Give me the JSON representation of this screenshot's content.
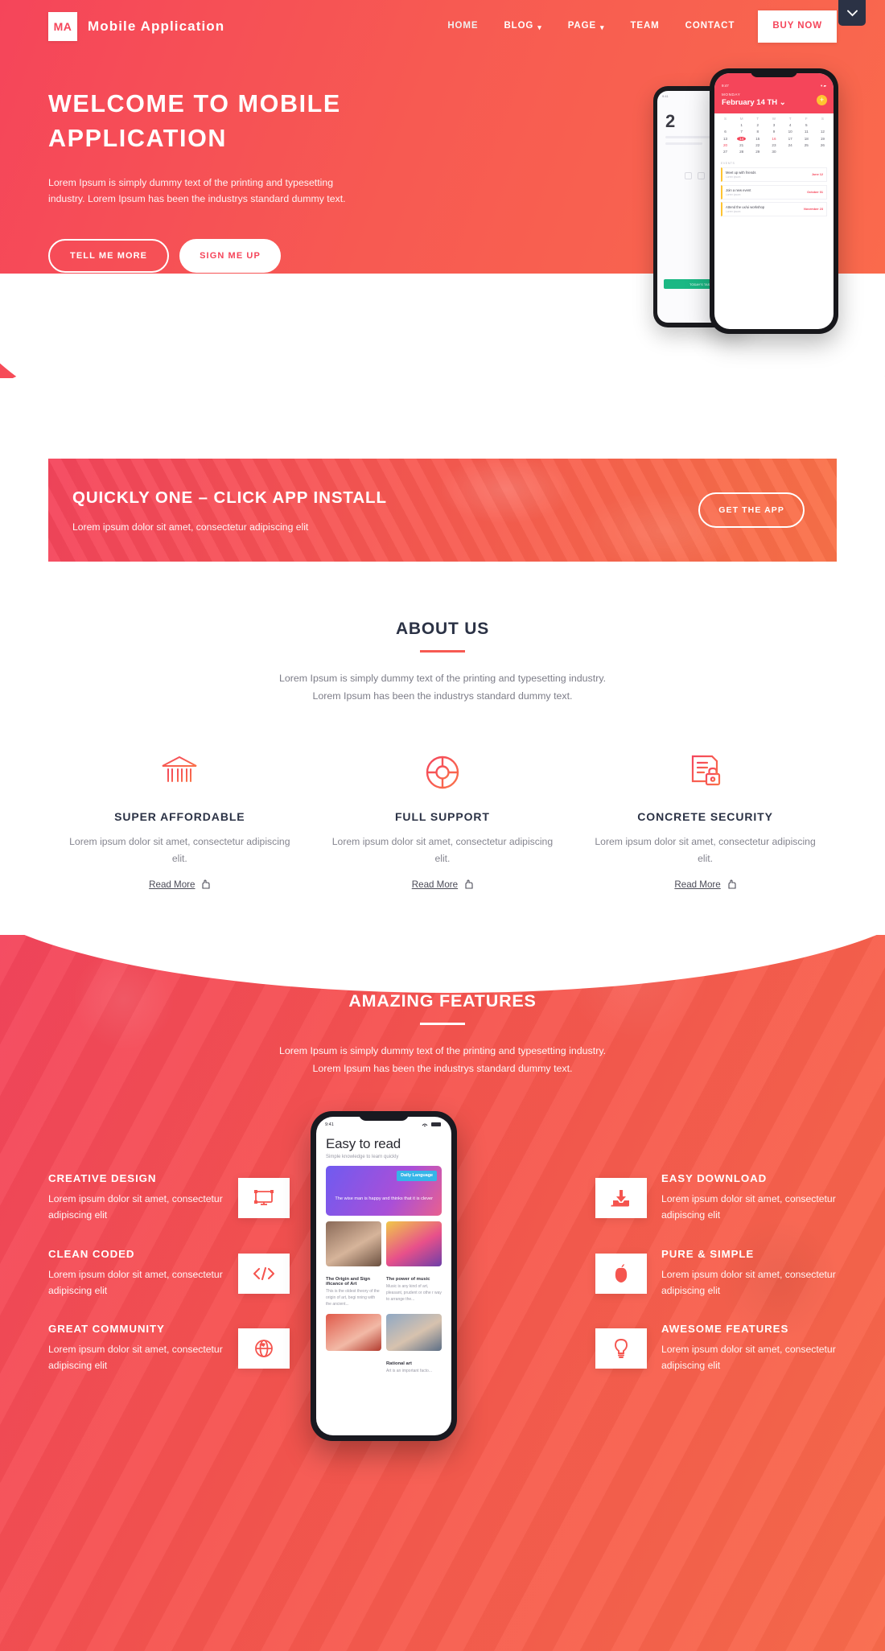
{
  "brand": {
    "badge": "MA",
    "name": "Mobile Application"
  },
  "nav": {
    "items": [
      {
        "label": "HOME",
        "caret": ""
      },
      {
        "label": "BLOG",
        "caret": "▾"
      },
      {
        "label": "PAGE",
        "caret": "▾"
      },
      {
        "label": "TEAM",
        "caret": ""
      },
      {
        "label": "CONTACT",
        "caret": ""
      }
    ],
    "cta": "BUY NOW",
    "scroll_toggle_icon": "chevron-down-icon"
  },
  "hero": {
    "title": "WELCOME TO MOBILE APPLICATION",
    "subtitle": "Lorem Ipsum is simply dummy text of the printing and typesetting industry. Lorem Ipsum has been the industrys standard dummy text.",
    "btn_primary": "TELL ME MORE",
    "btn_secondary": "SIGN ME UP",
    "phone_back": {
      "status": "9:41",
      "big_number": "2",
      "green_label": "TODAY'S TASK"
    },
    "phone_front": {
      "status_left": "9:47",
      "status_right": "▾ ▰",
      "weekday": "MONDAY",
      "date": "February 14 TH ⌄",
      "plus": "+",
      "dow": [
        "S",
        "M",
        "T",
        "W",
        "T",
        "F",
        "S"
      ],
      "weeks": [
        [
          "",
          "1",
          "2",
          "3",
          "4",
          "5"
        ],
        [
          "6",
          "7",
          "8",
          "9",
          "10",
          "11",
          "12"
        ],
        [
          "13",
          "14",
          "15",
          "16",
          "17",
          "18",
          "19"
        ],
        [
          "20",
          "21",
          "22",
          "23",
          "24",
          "25",
          "26"
        ],
        [
          "27",
          "28",
          "29",
          "30"
        ]
      ],
      "selected_day": "14",
      "highlight_day": "16",
      "events_label": "EVENTS",
      "events": [
        {
          "title": "Meet up with friends",
          "sub": "Lorem ipsum",
          "date": "June 12"
        },
        {
          "title": "Join a new event",
          "sub": "Lorem ipsum",
          "date": "October 01"
        },
        {
          "title": "Attend the ux/ui workshop",
          "sub": "Lorem ipsum",
          "date": "November 23"
        }
      ]
    }
  },
  "cta_banner": {
    "title": "QUICKLY ONE – CLICK APP INSTALL",
    "subtitle": "Lorem ipsum dolor sit amet, consectetur adipiscing elit",
    "button": "GET THE APP"
  },
  "about": {
    "title": "ABOUT US",
    "description": "Lorem Ipsum is simply dummy text of the printing and typesetting industry. Lorem Ipsum has been the industrys standard dummy text.",
    "cards": [
      {
        "icon": "bank-icon",
        "title": "SUPER AFFORDABLE",
        "description": "Lorem ipsum dolor sit amet, consectetur adipiscing elit.",
        "link": "Read More"
      },
      {
        "icon": "lifebuoy-icon",
        "title": "FULL SUPPORT",
        "description": "Lorem ipsum dolor sit amet, consectetur adipiscing elit.",
        "link": "Read More"
      },
      {
        "icon": "document-lock-icon",
        "title": "CONCRETE SECURITY",
        "description": "Lorem ipsum dolor sit amet, consectetur adipiscing elit.",
        "link": "Read More"
      }
    ]
  },
  "features": {
    "title": "AMAZING FEATURES",
    "description": "Lorem Ipsum is simply dummy text of the printing and typesetting industry. Lorem Ipsum has been the industrys standard dummy text.",
    "left": [
      {
        "icon": "design-frame-icon",
        "title": "CREATIVE DESIGN",
        "description": "Lorem ipsum dolor sit amet, consectetur adipiscing elit"
      },
      {
        "icon": "code-icon",
        "title": "CLEAN CODED",
        "description": "Lorem ipsum dolor sit amet, consectetur adipiscing elit"
      },
      {
        "icon": "globe-icon",
        "title": "GREAT COMMUNITY",
        "description": "Lorem ipsum dolor sit amet, consectetur adipiscing elit"
      }
    ],
    "right": [
      {
        "icon": "download-icon",
        "title": "EASY DOWNLOAD",
        "description": "Lorem ipsum dolor sit amet, consectetur adipiscing elit"
      },
      {
        "icon": "apple-icon",
        "title": "PURE & SIMPLE",
        "description": "Lorem ipsum dolor sit amet, consectetur adipiscing elit"
      },
      {
        "icon": "lightbulb-icon",
        "title": "AWESOME FEATURES",
        "description": "Lorem ipsum dolor sit amet, consectetur adipiscing elit"
      }
    ],
    "phone": {
      "status_left": "9:41",
      "heading": "Easy to read",
      "subheading": "Simple knowledge to learn quickly",
      "hero_badge": "Daily Language",
      "hero_text": "The wise man is happy and thinks that it is clever",
      "card_music_title": "The power of music",
      "card_music_body": "Music is any kind of art, pleasant, prudent or othe r way to arrange the...",
      "card_origin_title": "The Origin and Sign ificance of Art",
      "card_origin_body": "This is the oldest theory of the origin of art, begi nning with the ancient...",
      "card_rational_title": "Rational art",
      "card_rational_body": "Art is an important facto..."
    }
  },
  "colors": {
    "accent": "#f5455a",
    "accent_orange": "#fa6b4c",
    "dark": "#2b3245",
    "muted": "#7d7d88"
  }
}
